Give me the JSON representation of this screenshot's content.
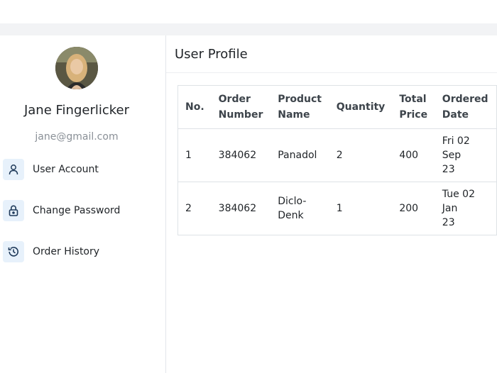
{
  "profile": {
    "name": "Jane Fingerlicker",
    "email": "jane@gmail.com"
  },
  "sidebar": {
    "items": [
      {
        "label": "User Account",
        "icon": "user-icon"
      },
      {
        "label": "Change Password",
        "icon": "lock-icon"
      },
      {
        "label": "Order History",
        "icon": "history-icon"
      }
    ]
  },
  "main": {
    "title": "User Profile"
  },
  "orders": {
    "headers": [
      [
        "No."
      ],
      [
        "Order",
        "Number"
      ],
      [
        "Product",
        "Name"
      ],
      [
        "Quantity"
      ],
      [
        "Total",
        "Price"
      ],
      [
        "Ordered",
        "Date"
      ]
    ],
    "rows": [
      {
        "no": "1",
        "order_number": "384062",
        "product": [
          "Panadol"
        ],
        "quantity": "2",
        "total": "400",
        "date": [
          "Fri 02 Sep",
          "23"
        ]
      },
      {
        "no": "2",
        "order_number": "384062",
        "product": [
          "Diclo-",
          "Denk"
        ],
        "quantity": "1",
        "total": "200",
        "date": [
          "Tue 02 Jan",
          "23"
        ]
      }
    ]
  },
  "colors": {
    "icon_bg": "#e7f1fb",
    "icon_stroke": "#1f3a5a",
    "page_strip": "#f2f3f5"
  }
}
